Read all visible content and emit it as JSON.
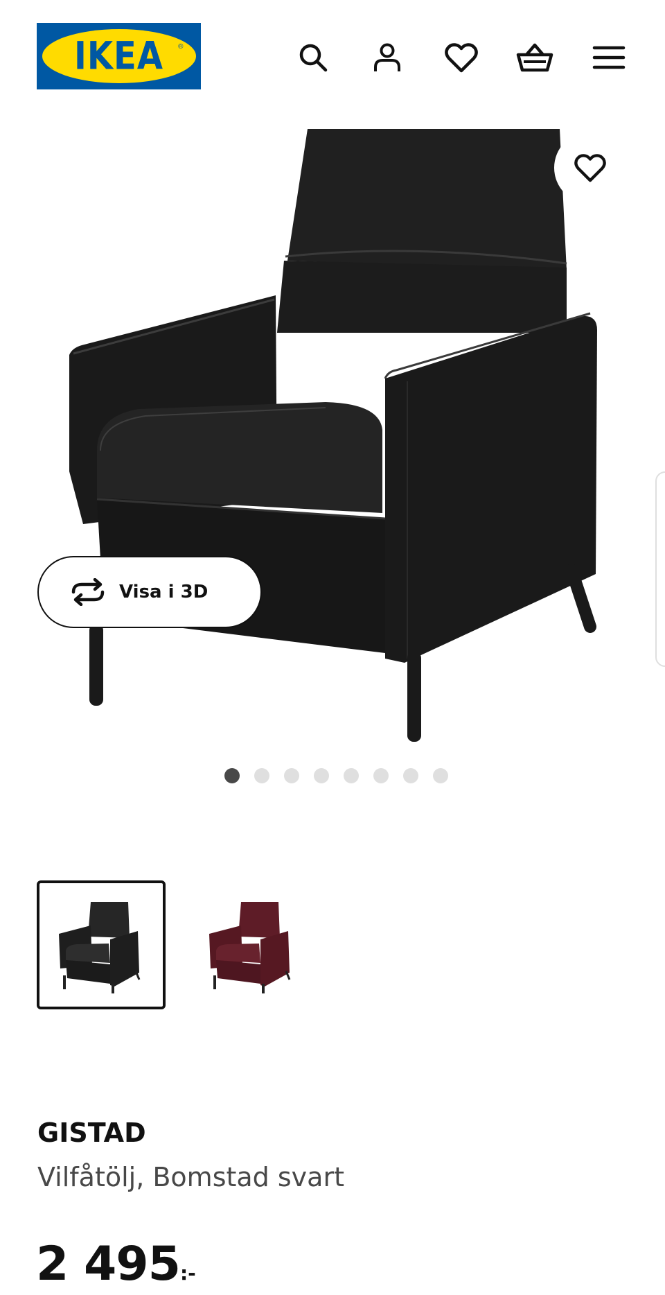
{
  "header": {
    "logo_text": "IKEA",
    "logo_reg": "®",
    "icons": [
      "search-icon",
      "user-icon",
      "heart-icon",
      "basket-icon",
      "menu-icon"
    ]
  },
  "gallery": {
    "view3d_label": "Visa i 3D",
    "image_count": 8,
    "active_index": 0
  },
  "variants": [
    {
      "color": "#2a2a2a",
      "selected": true
    },
    {
      "color": "#5a1a24",
      "selected": false
    }
  ],
  "product": {
    "name": "GISTAD",
    "description": "Vilfåtölj, Bomstad svart",
    "price": "2 495",
    "price_suffix": ":-"
  },
  "colors": {
    "ikea_blue": "#0058a3",
    "ikea_yellow": "#ffdb00",
    "text_primary": "#111111",
    "text_secondary": "#484848",
    "dot_inactive": "#dfdfdf",
    "dot_active": "#484848"
  }
}
